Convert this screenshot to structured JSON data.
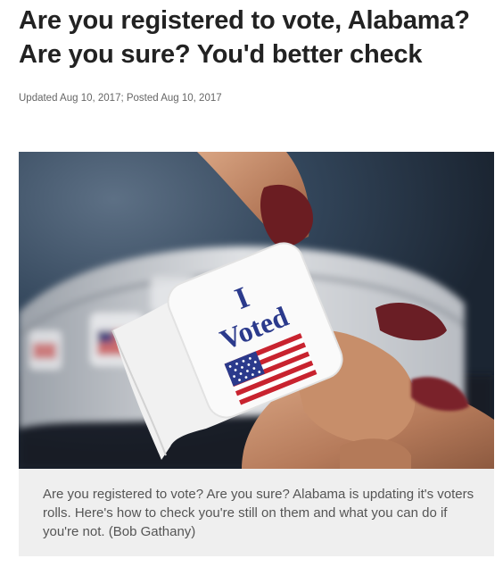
{
  "article": {
    "headline_line1": "Are you registered to vote, Alabama?",
    "headline_line2": "Are you sure? You'd better check",
    "meta": "Updated Aug 10, 2017; Posted Aug 10, 2017"
  },
  "figure": {
    "image_text": [
      "I",
      "Voted"
    ],
    "caption": "Are you registered to vote? Are you sure? Alabama is updating it's voters rolls. Here's how to check you're still on them and what you can do if you're not. (Bob Gathany)"
  }
}
